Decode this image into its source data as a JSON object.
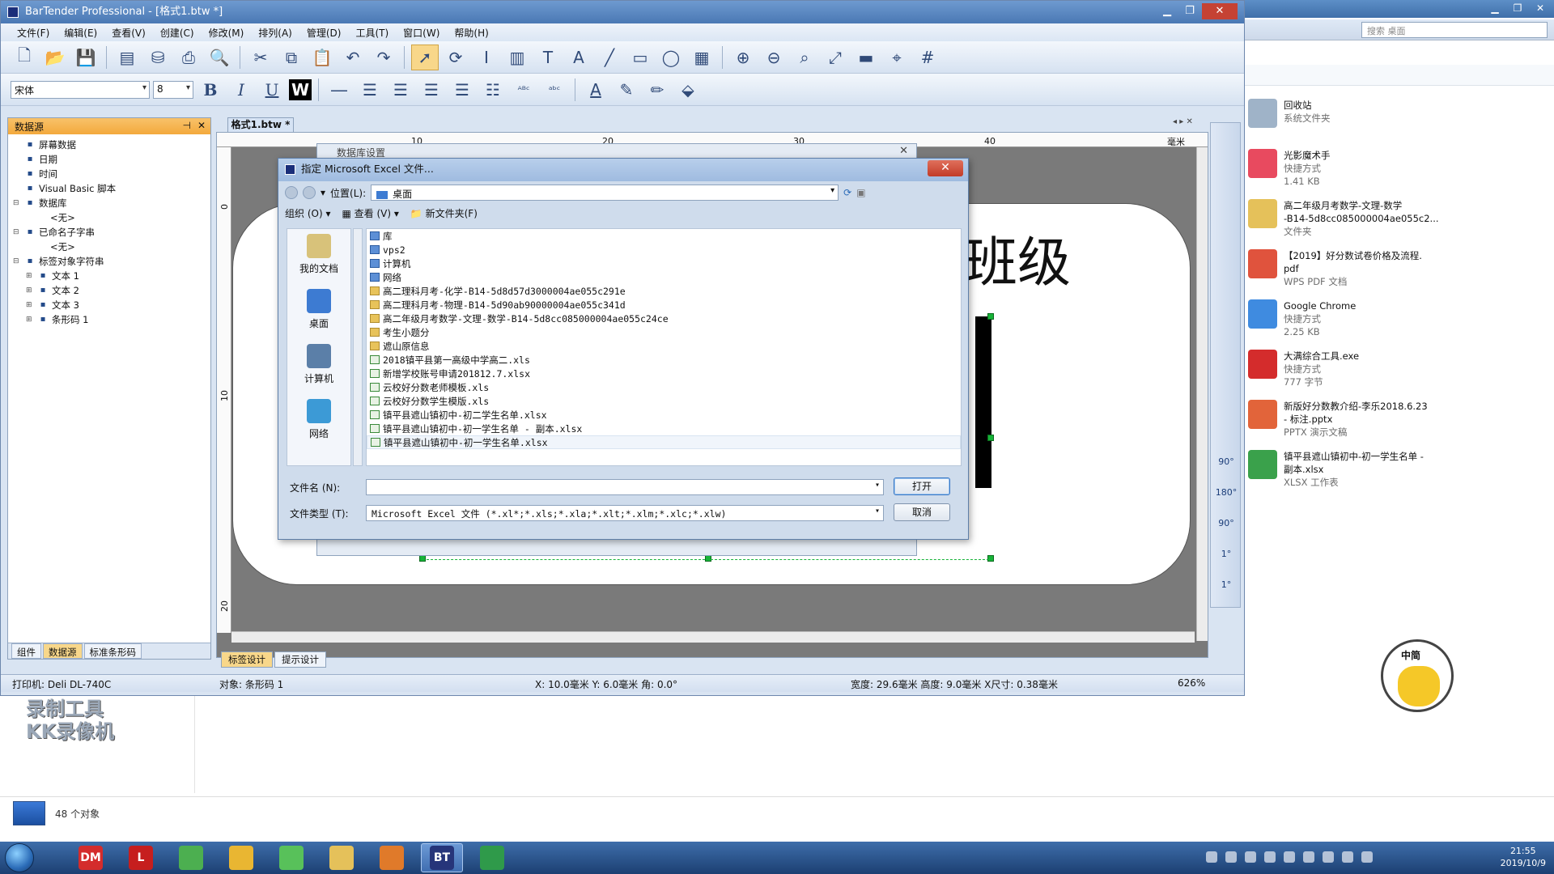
{
  "bt_window": {
    "title": "BarTender Professional - [格式1.btw *]",
    "menu": [
      "文件(F)",
      "编辑(E)",
      "查看(V)",
      "创建(C)",
      "修改(M)",
      "排列(A)",
      "管理(D)",
      "工具(T)",
      "窗口(W)",
      "帮助(H)"
    ],
    "font_name": "宋体",
    "font_size": "8",
    "bold_label": "B",
    "italic_label": "I",
    "underline_label": "U",
    "wordwrap_label": "W"
  },
  "datasource_panel": {
    "title": "数据源",
    "tree": [
      {
        "label": "屏幕数据",
        "icon": "screen-icon",
        "expand": ""
      },
      {
        "label": "日期",
        "icon": "calendar-icon",
        "expand": ""
      },
      {
        "label": "时间",
        "icon": "clock-icon",
        "expand": ""
      },
      {
        "label": "Visual Basic 脚本",
        "icon": "vb-script-icon",
        "expand": ""
      },
      {
        "label": "数据库",
        "icon": "database-icon",
        "expand": "⊟"
      },
      {
        "label": "<无>",
        "icon": "",
        "expand": "",
        "indent": 2
      },
      {
        "label": "已命名子字串",
        "icon": "named-substring-icon",
        "expand": "⊟"
      },
      {
        "label": "<无>",
        "icon": "",
        "expand": "",
        "indent": 2
      },
      {
        "label": "标签对象字符串",
        "icon": "label-object-icon",
        "expand": "⊟"
      },
      {
        "label": "文本 1",
        "icon": "text-icon",
        "expand": "⊞",
        "indent": 1
      },
      {
        "label": "文本 2",
        "icon": "text-icon",
        "expand": "⊞",
        "indent": 1
      },
      {
        "label": "文本 3",
        "icon": "text-icon",
        "expand": "⊞",
        "indent": 1
      },
      {
        "label": "条形码 1",
        "icon": "barcode-icon",
        "expand": "⊞",
        "indent": 1
      }
    ],
    "tabs": [
      "组件",
      "数据源",
      "标准条形码"
    ],
    "selected_tab": "数据源"
  },
  "document": {
    "tab": "格式1.btw *",
    "ruler_h": [
      "10",
      "20",
      "30",
      "40"
    ],
    "ruler_unit": "毫米",
    "ruler_v": [
      "0",
      "10",
      "20"
    ],
    "label_text": "班级",
    "bottom_tabs": [
      "标签设计",
      "提示设计"
    ],
    "selected_bottom_tab": "标签设计",
    "rotation_labels": [
      "90°",
      "180°",
      "90°",
      "1°",
      "1°"
    ]
  },
  "background_dialog": {
    "title": "数据库设置"
  },
  "file_dialog": {
    "title": "指定 Microsoft Excel 文件...",
    "location_label": "位置(L):",
    "location_value": "桌面",
    "organize": "组织 (O)",
    "view": "查看 (V)",
    "new_folder": "新文件夹(F)",
    "places": [
      {
        "label": "我的文档",
        "icon": "documents-icon",
        "color": "#d8c27a"
      },
      {
        "label": "桌面",
        "icon": "desktop-icon",
        "color": "#3d7bd2"
      },
      {
        "label": "计算机",
        "icon": "computer-icon",
        "color": "#5b7fa8"
      },
      {
        "label": "网络",
        "icon": "network-icon",
        "color": "#3c9ad6"
      }
    ],
    "files": [
      {
        "name": "库",
        "type": "sys"
      },
      {
        "name": "vps2",
        "type": "sys"
      },
      {
        "name": "计算机",
        "type": "sys"
      },
      {
        "name": "网络",
        "type": "sys"
      },
      {
        "name": "高二理科月考-化学-B14-5d8d57d3000004ae055c291e",
        "type": "folder"
      },
      {
        "name": "高二理科月考-物理-B14-5d90ab90000004ae055c341d",
        "type": "folder"
      },
      {
        "name": "高二年级月考数学-文理-数学-B14-5d8cc085000004ae055c24ce",
        "type": "folder"
      },
      {
        "name": "考生小题分",
        "type": "folder"
      },
      {
        "name": "遮山原信息",
        "type": "folder"
      },
      {
        "name": "2018镇平县第一高级中学高二.xls",
        "type": "xls"
      },
      {
        "name": "新增学校账号申请201812.7.xlsx",
        "type": "xls"
      },
      {
        "name": "云校好分数老师模板.xls",
        "type": "xls"
      },
      {
        "name": "云校好分数学生模版.xls",
        "type": "xls"
      },
      {
        "name": "镇平县遮山镇初中-初二学生名单.xlsx",
        "type": "xls"
      },
      {
        "name": "镇平县遮山镇初中-初一学生名单 - 副本.xlsx",
        "type": "xls"
      },
      {
        "name": "镇平县遮山镇初中-初一学生名单.xlsx",
        "type": "xls",
        "hover": true
      }
    ],
    "filename_label": "文件名 (N):",
    "filename_value": "",
    "filetype_label": "文件类型 (T):",
    "filetype_value": "Microsoft Excel 文件 (*.xl*;*.xls;*.xla;*.xlt;*.xlm;*.xlc;*.xlw)",
    "open_button": "打开",
    "cancel_button": "取消"
  },
  "statusbar": {
    "printer": "打印机: Deli DL-740C",
    "object": "对象: 条形码 1",
    "position": "X: 10.0毫米  Y: 6.0毫米  角: 0.0°",
    "size": "宽度: 29.6毫米  高度: 9.0毫米  X尺寸: 0.38毫米",
    "zoom": "626%"
  },
  "explorer": {
    "search_placeholder": "搜索 桌面",
    "items": [
      {
        "name": "回收站",
        "sub1": "系统文件夹",
        "sub2": "",
        "color": "#9fb3c8"
      },
      {
        "name": "光影魔术手",
        "sub1": "快捷方式",
        "sub2": "1.41 KB",
        "color": "#e84a5f"
      },
      {
        "name": "高二年级月考数学-文理-数学",
        "name2": "-B14-5d8cc085000004ae055c2...",
        "sub1": "文件夹",
        "sub2": "",
        "color": "#e5c15a"
      },
      {
        "name": "【2019】好分数试卷价格及流程.",
        "name2": "pdf",
        "sub1": "WPS PDF 文档",
        "sub2": "",
        "color": "#e0533d"
      },
      {
        "name": "Google Chrome",
        "sub1": "快捷方式",
        "sub2": "2.25 KB",
        "color": "#3f8be0"
      },
      {
        "name": "大满综合工具.exe",
        "sub1": "快捷方式",
        "sub2": "777 字节",
        "color": "#d42c2c"
      },
      {
        "name": "新版好分数教介绍-李乐2018.6.23",
        "name2": "- 标注.pptx",
        "sub1": "PPTX 演示文稿",
        "sub2": "",
        "color": "#e2643a"
      },
      {
        "name": "镇平县遮山镇初中-初一学生名单 -",
        "name2": "副本.xlsx",
        "sub1": "XLSX 工作表",
        "sub2": "",
        "color": "#3aa14b"
      }
    ]
  },
  "watermark": {
    "line1": "录制工具",
    "line2": "KK录像机"
  },
  "desktop_status": {
    "count": "48 个对象"
  },
  "sticker": {
    "text": "中简"
  },
  "taskbar": {
    "apps": [
      {
        "label": "DM",
        "icon": "dm-icon",
        "color": "#d42c2c"
      },
      {
        "label": "L",
        "icon": "l-app-icon",
        "color": "#c61e1e"
      },
      {
        "label": "",
        "icon": "refresh-app-icon",
        "color": "#4caf50"
      },
      {
        "label": "",
        "icon": "chrome-icon",
        "color": "#e9b632"
      },
      {
        "label": "",
        "icon": "wechat-icon",
        "color": "#58c15a"
      },
      {
        "label": "",
        "icon": "folder-icon",
        "color": "#e5c15a"
      },
      {
        "label": "",
        "icon": "mascot-icon",
        "color": "#e07a2a"
      },
      {
        "label": "BT",
        "icon": "bartender-icon",
        "color": "#26357a",
        "active": true
      },
      {
        "label": "",
        "icon": "green-tool-icon",
        "color": "#2f9a4a"
      }
    ],
    "time": "21:55",
    "date": "2019/10/9"
  }
}
